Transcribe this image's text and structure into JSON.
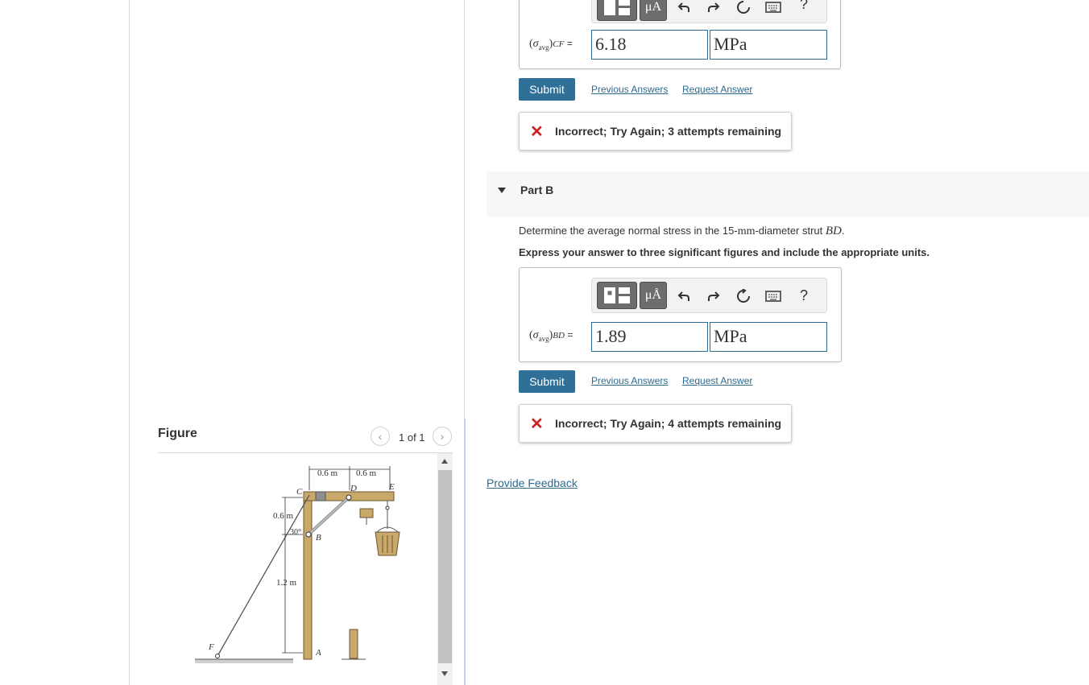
{
  "part_a": {
    "variable_sub": "avg",
    "variable_tail": "CF",
    "equals": "=",
    "value": "6.18",
    "units": "MPa",
    "submit_label": "Submit",
    "previous_answers_label": "Previous Answers",
    "request_answer_label": "Request Answer",
    "feedback": "Incorrect; Try Again; 3 attempts remaining"
  },
  "part_b": {
    "title": "Part B",
    "question_prefix": "Determine the average normal stress in the 15-",
    "question_unit": "mm",
    "question_mid": "-diameter strut ",
    "question_var": "BD",
    "question_end": ".",
    "instruction": "Express your answer to three significant figures and include the appropriate units.",
    "variable_sub": "avg",
    "variable_tail": "BD",
    "equals": "=",
    "value": "1.89",
    "units": "MPa",
    "submit_label": "Submit",
    "previous_answers_label": "Previous Answers",
    "request_answer_label": "Request Answer",
    "feedback": "Incorrect; Try Again; 4 attempts remaining"
  },
  "toolbar": {
    "units_label": "μÅ",
    "units_label_top": "μA",
    "help_label": "?",
    "icons": [
      "templates-icon",
      "units-icon",
      "undo-icon",
      "redo-icon",
      "reset-icon",
      "keyboard-icon",
      "help-icon"
    ]
  },
  "provide_feedback_label": "Provide Feedback",
  "figure": {
    "title": "Figure",
    "pager": "1 of 1",
    "labels": {
      "dim_top_left": "0.6 m",
      "dim_top_right": "0.6 m",
      "dim_left_upper": "0.6 m",
      "dim_left_lower": "1.2 m",
      "angle": "30°",
      "C": "C",
      "D": "D",
      "E": "E",
      "B": "B",
      "A": "A",
      "F": "F"
    }
  },
  "colors": {
    "submit": "#2f6f98",
    "link": "#2d6a8f",
    "incorrect": "#cc2222",
    "wood": "#c8a96a"
  }
}
